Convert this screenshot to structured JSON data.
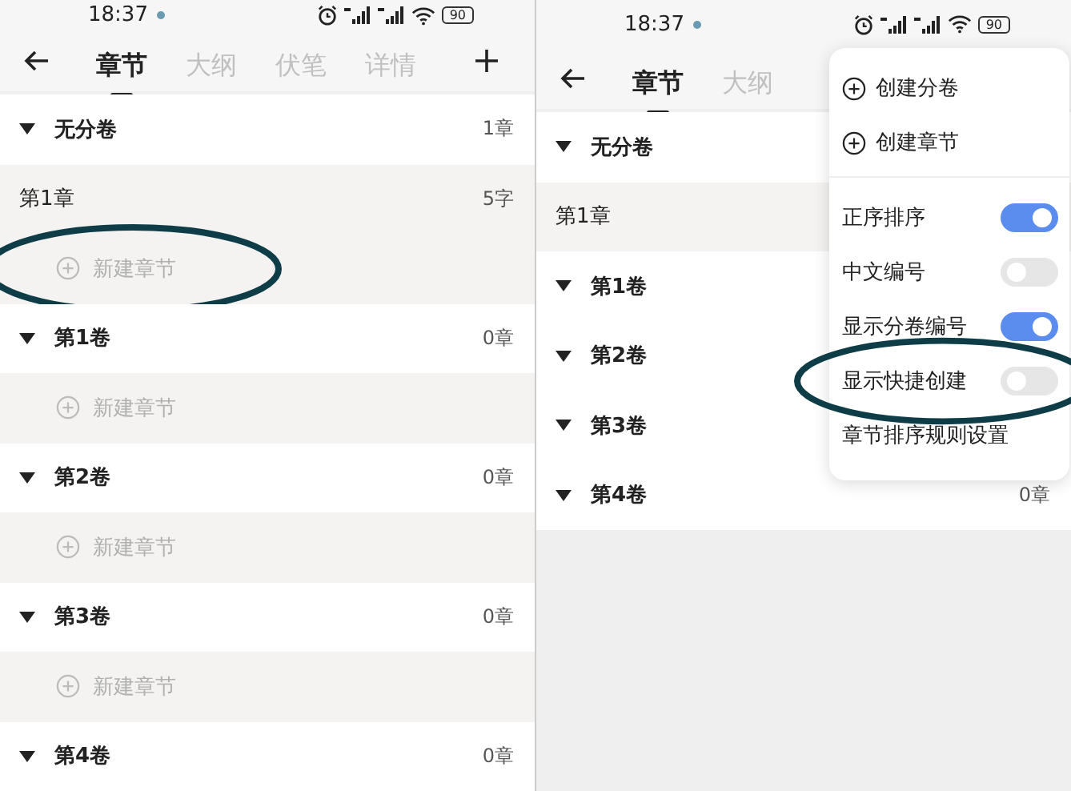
{
  "screens": [
    {
      "status_bar": {
        "time": "18:37",
        "battery": "90"
      },
      "tabs": [
        {
          "label": "章节",
          "selected": true
        },
        {
          "label": "大纲",
          "selected": false
        },
        {
          "label": "伏笔",
          "selected": false
        },
        {
          "label": "详情",
          "selected": false
        }
      ],
      "add_button": true,
      "rows": [
        {
          "kind": "volume",
          "title": "无分卷",
          "count": "1章"
        },
        {
          "kind": "chapter",
          "title": "第1章",
          "count": "5字"
        },
        {
          "kind": "new",
          "title": "新建章节",
          "circled": true
        },
        {
          "kind": "volume",
          "title": "第1卷",
          "count": "0章"
        },
        {
          "kind": "new",
          "title": "新建章节",
          "circled": false
        },
        {
          "kind": "volume",
          "title": "第2卷",
          "count": "0章"
        },
        {
          "kind": "new",
          "title": "新建章节",
          "circled": false
        },
        {
          "kind": "volume",
          "title": "第3卷",
          "count": "0章"
        },
        {
          "kind": "new",
          "title": "新建章节",
          "circled": false
        },
        {
          "kind": "volume",
          "title": "第4卷",
          "count": "0章"
        }
      ]
    },
    {
      "status_bar": {
        "time": "18:37",
        "battery": "90"
      },
      "tabs": [
        {
          "label": "章节",
          "selected": true
        },
        {
          "label": "大纲",
          "selected": false
        }
      ],
      "add_button": false,
      "rows": [
        {
          "kind": "volume",
          "title": "无分卷"
        },
        {
          "kind": "chapter",
          "title": "第1章"
        },
        {
          "kind": "volume",
          "title": "第1卷"
        },
        {
          "kind": "volume",
          "title": "第2卷"
        },
        {
          "kind": "volume",
          "title": "第3卷"
        },
        {
          "kind": "volume",
          "title": "第4卷",
          "count": "0章"
        }
      ],
      "menu": {
        "items": [
          {
            "kind": "action",
            "label": "创建分卷"
          },
          {
            "kind": "action",
            "label": "创建章节"
          },
          {
            "kind": "toggle",
            "label": "正序排序",
            "on": true,
            "circled": false
          },
          {
            "kind": "toggle",
            "label": "中文编号",
            "on": false,
            "circled": false
          },
          {
            "kind": "toggle",
            "label": "显示分卷编号",
            "on": true,
            "circled": false
          },
          {
            "kind": "toggle",
            "label": "显示快捷创建",
            "on": false,
            "circled": true
          },
          {
            "kind": "link",
            "label": "章节排序规则设置"
          }
        ]
      }
    }
  ]
}
